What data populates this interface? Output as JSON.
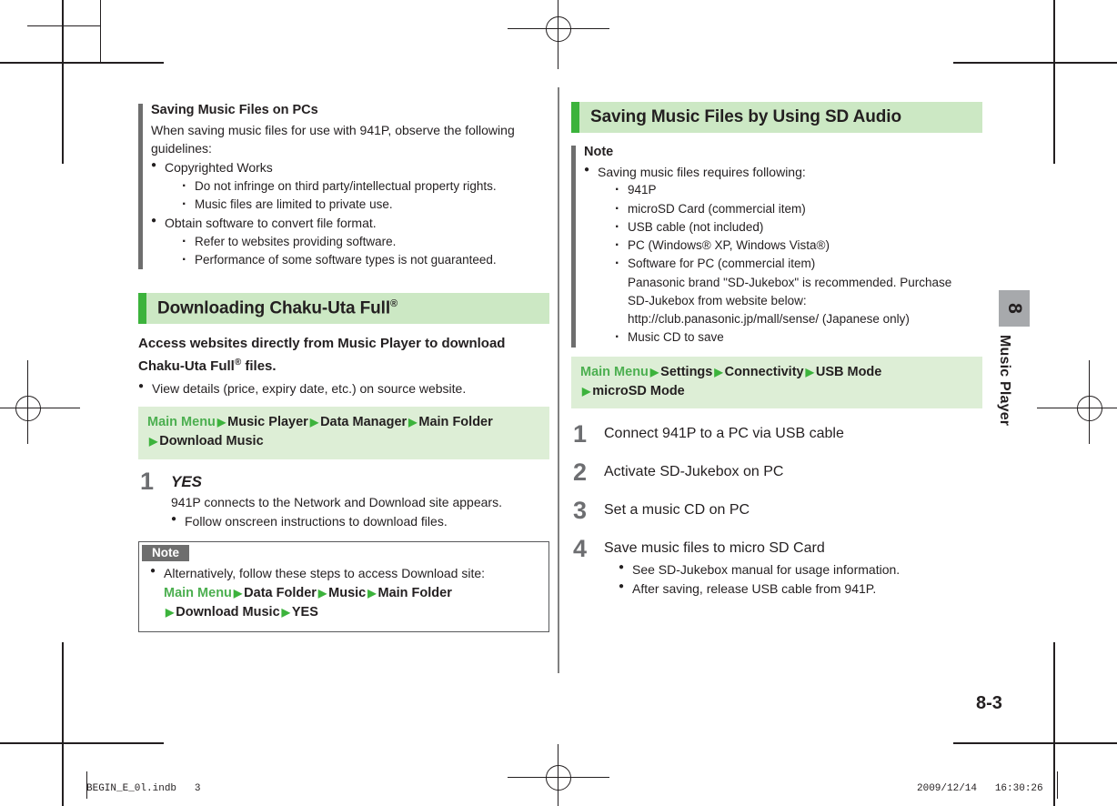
{
  "page": {
    "number": "8-3",
    "chapter_tab": {
      "number": "8",
      "label": "Music Player"
    }
  },
  "footer": {
    "file": "BEGIN_E_0l.indb   3",
    "timestamp": "2009/12/14   16:30:26"
  },
  "left_column": {
    "pc_note": {
      "title": "Saving Music Files on PCs",
      "intro_line1": "When saving music files for use with 941P, observe the following",
      "intro_line2": "guidelines:",
      "bullets": [
        {
          "text": "Copyrighted Works",
          "sub": [
            "Do not infringe on third party/intellectual property rights.",
            "Music files are limited to private use."
          ]
        },
        {
          "text": "Obtain software to convert file format.",
          "sub": [
            "Refer to websites providing software.",
            "Performance of some software types is not guaranteed."
          ]
        }
      ]
    },
    "section": {
      "heading": "Downloading Chaku-Uta Full",
      "heading_sup": "®",
      "lead_line1": "Access websites directly from Music Player to download",
      "lead_line2_pre": "Chaku-Uta Full",
      "lead_line2_sup": "®",
      "lead_line2_post": " files.",
      "bullet": "View details (price, expiry date, etc.) on source website.",
      "navpath": {
        "start": "Main Menu",
        "items": [
          "Music Player",
          "Data Manager",
          "Main Folder",
          "Download Music"
        ]
      },
      "step": {
        "num": "1",
        "title": "YES",
        "desc": "941P connects to the Network and Download site appears.",
        "bullet": "Follow onscreen instructions to download files."
      },
      "note": {
        "tag": "Note",
        "bullet": "Alternatively, follow these steps to access Download site:",
        "navpath": {
          "start": "Main Menu",
          "items": [
            "Data Folder",
            "Music",
            "Main Folder",
            "Download Music",
            "YES"
          ]
        }
      }
    }
  },
  "right_column": {
    "heading": "Saving Music Files by Using SD Audio",
    "note": {
      "tag": "Note",
      "bullet": "Saving music files requires following:",
      "sub": [
        "941P",
        "microSD Card (commercial item)",
        "USB cable (not included)",
        "PC (Windows® XP, Windows Vista®)",
        "Software for PC (commercial item)",
        "Music CD to save"
      ],
      "software_detail": [
        "Panasonic brand \"SD-Jukebox\" is recommended. Purchase",
        "SD-Jukebox from website below:",
        "http://club.panasonic.jp/mall/sense/ (Japanese only)"
      ]
    },
    "navpath": {
      "start": "Main Menu",
      "items": [
        "Settings",
        "Connectivity",
        "USB Mode",
        "microSD Mode"
      ]
    },
    "steps": [
      {
        "num": "1",
        "title": "Connect 941P to a PC via USB cable",
        "bullets": []
      },
      {
        "num": "2",
        "title": "Activate SD-Jukebox on PC",
        "bullets": []
      },
      {
        "num": "3",
        "title": "Set a music CD on PC",
        "bullets": []
      },
      {
        "num": "4",
        "title": "Save music files to micro SD Card",
        "bullets": [
          "See SD-Jukebox manual for usage information.",
          "After saving, release USB cable from 941P."
        ]
      }
    ]
  },
  "colors": {
    "accent_green": "#3cb33c",
    "heading_bg": "#cce8c4",
    "navpath_bg": "#ddeed6",
    "gray_bar": "#6e6e6e",
    "tab_gray": "#a7a9ac"
  }
}
